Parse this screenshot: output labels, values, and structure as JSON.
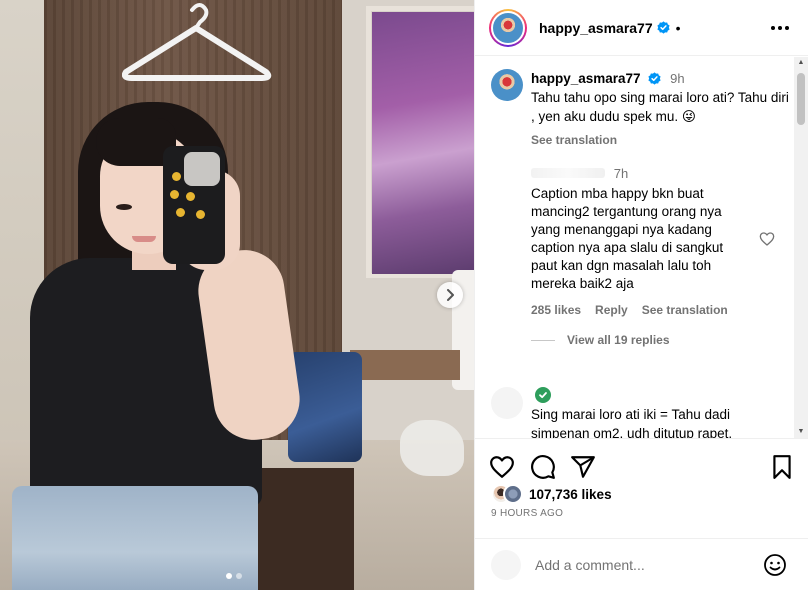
{
  "post": {
    "username": "happy_asmara77",
    "header_separator": "•",
    "caption": {
      "username": "happy_asmara77",
      "time": "9h",
      "text": "Tahu tahu opo sing marai loro ati? Tahu diri , yen aku dudu spek mu. 😜",
      "see_translation": "See translation"
    },
    "comments": [
      {
        "time": "7h",
        "text": "Caption mba happy bkn buat mancing2 tergantung orang nya yang menanggapi nya kadang caption nya apa slalu di sangkut paut kan dgn masalah lalu toh mereka baik2 aja",
        "likes": "285 likes",
        "reply": "Reply",
        "see_translation": "See translation",
        "view_replies": "View all 19 replies"
      },
      {
        "text": "Sing marai loro ati iki = Tahu dadi simpenan om2, udh ditutup rapet,"
      }
    ],
    "likes": "107,736 likes",
    "posted_ago": "9 HOURS AGO",
    "add_comment_placeholder": "Add a comment...",
    "carousel": {
      "count": 2,
      "active": 0
    }
  },
  "colors": {
    "verified": "#0095f6",
    "muted_text": "#737373",
    "divider": "#efefef",
    "badge_green": "#2e9e5c"
  },
  "icons": {
    "more": "more-horizontal-icon",
    "verified": "verified-badge-icon",
    "like": "heart-icon",
    "comment": "comment-bubble-icon",
    "share": "paper-plane-icon",
    "save": "bookmark-icon",
    "emoji": "smiley-icon",
    "next": "chevron-right-icon"
  }
}
